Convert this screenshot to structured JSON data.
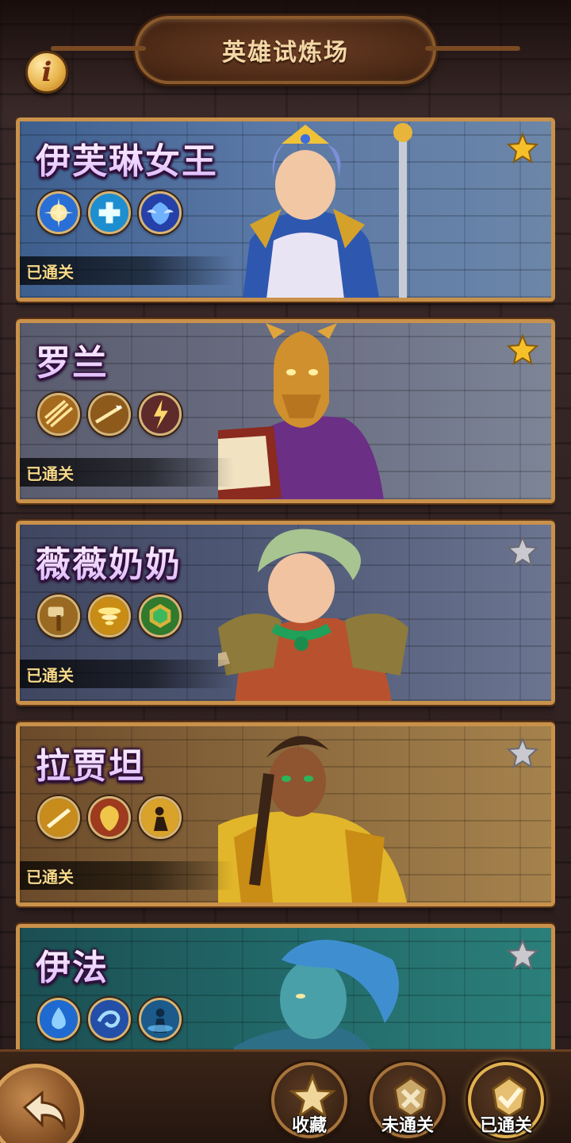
{
  "header": {
    "title": "英雄试炼场",
    "info_icon": "info-icon",
    "info_glyph": "i"
  },
  "heroes": [
    {
      "name": "伊芙琳女王",
      "status": "已通关",
      "starred": true,
      "skills": [
        "holy-orb-icon",
        "heal-plus-icon",
        "shield-wings-icon"
      ],
      "theme": "#4a6fa0"
    },
    {
      "name": "罗兰",
      "status": "已通关",
      "starred": true,
      "skills": [
        "arrow-volley-icon",
        "spear-throw-icon",
        "lightning-strike-icon"
      ],
      "theme": "#5a4e6a"
    },
    {
      "name": "薇薇奶奶",
      "status": "已通关",
      "starred": false,
      "skills": [
        "hammer-slam-icon",
        "whirlwind-icon",
        "emerald-shield-icon"
      ],
      "theme": "#4a5670"
    },
    {
      "name": "拉贾坦",
      "status": "已通关",
      "starred": false,
      "skills": [
        "blade-dash-icon",
        "golden-shield-icon",
        "warrior-silhouette-icon"
      ],
      "theme": "#7a5a32"
    },
    {
      "name": "伊法",
      "status": "",
      "starred": false,
      "skills": [
        "water-drop-icon",
        "water-whirl-icon",
        "water-spirit-icon"
      ],
      "theme": "#1f5a5a"
    }
  ],
  "footer": {
    "back_icon": "back-arrow-icon",
    "filters": [
      {
        "label": "收藏",
        "icon": "star-icon",
        "active": false
      },
      {
        "label": "未通关",
        "icon": "crossed-swords-icon",
        "active": false
      },
      {
        "label": "已通关",
        "icon": "checkmark-badge-icon",
        "active": true
      }
    ]
  },
  "colors": {
    "frame_gold": "#c9914a",
    "status_text": "#f6d98a",
    "star_gold": "#f5c02a",
    "star_grey": "#c9c9cf"
  }
}
